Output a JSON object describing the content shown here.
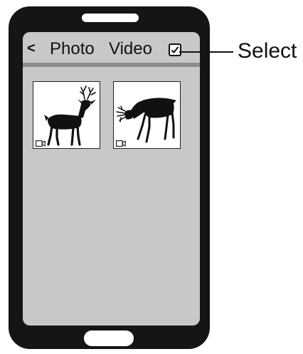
{
  "header": {
    "back_label": "<",
    "photo_label": "Photo",
    "video_label": "Video"
  },
  "callout": {
    "select_label": "Select"
  },
  "thumbnails": [
    {
      "subject": "standing-deer-silhouette",
      "media_type": "video"
    },
    {
      "subject": "grazing-deer-silhouette",
      "media_type": "video"
    }
  ],
  "colors": {
    "phone_body": "#151515",
    "screen": "#c8c8c9",
    "header_divider": "#8d8d8e"
  }
}
